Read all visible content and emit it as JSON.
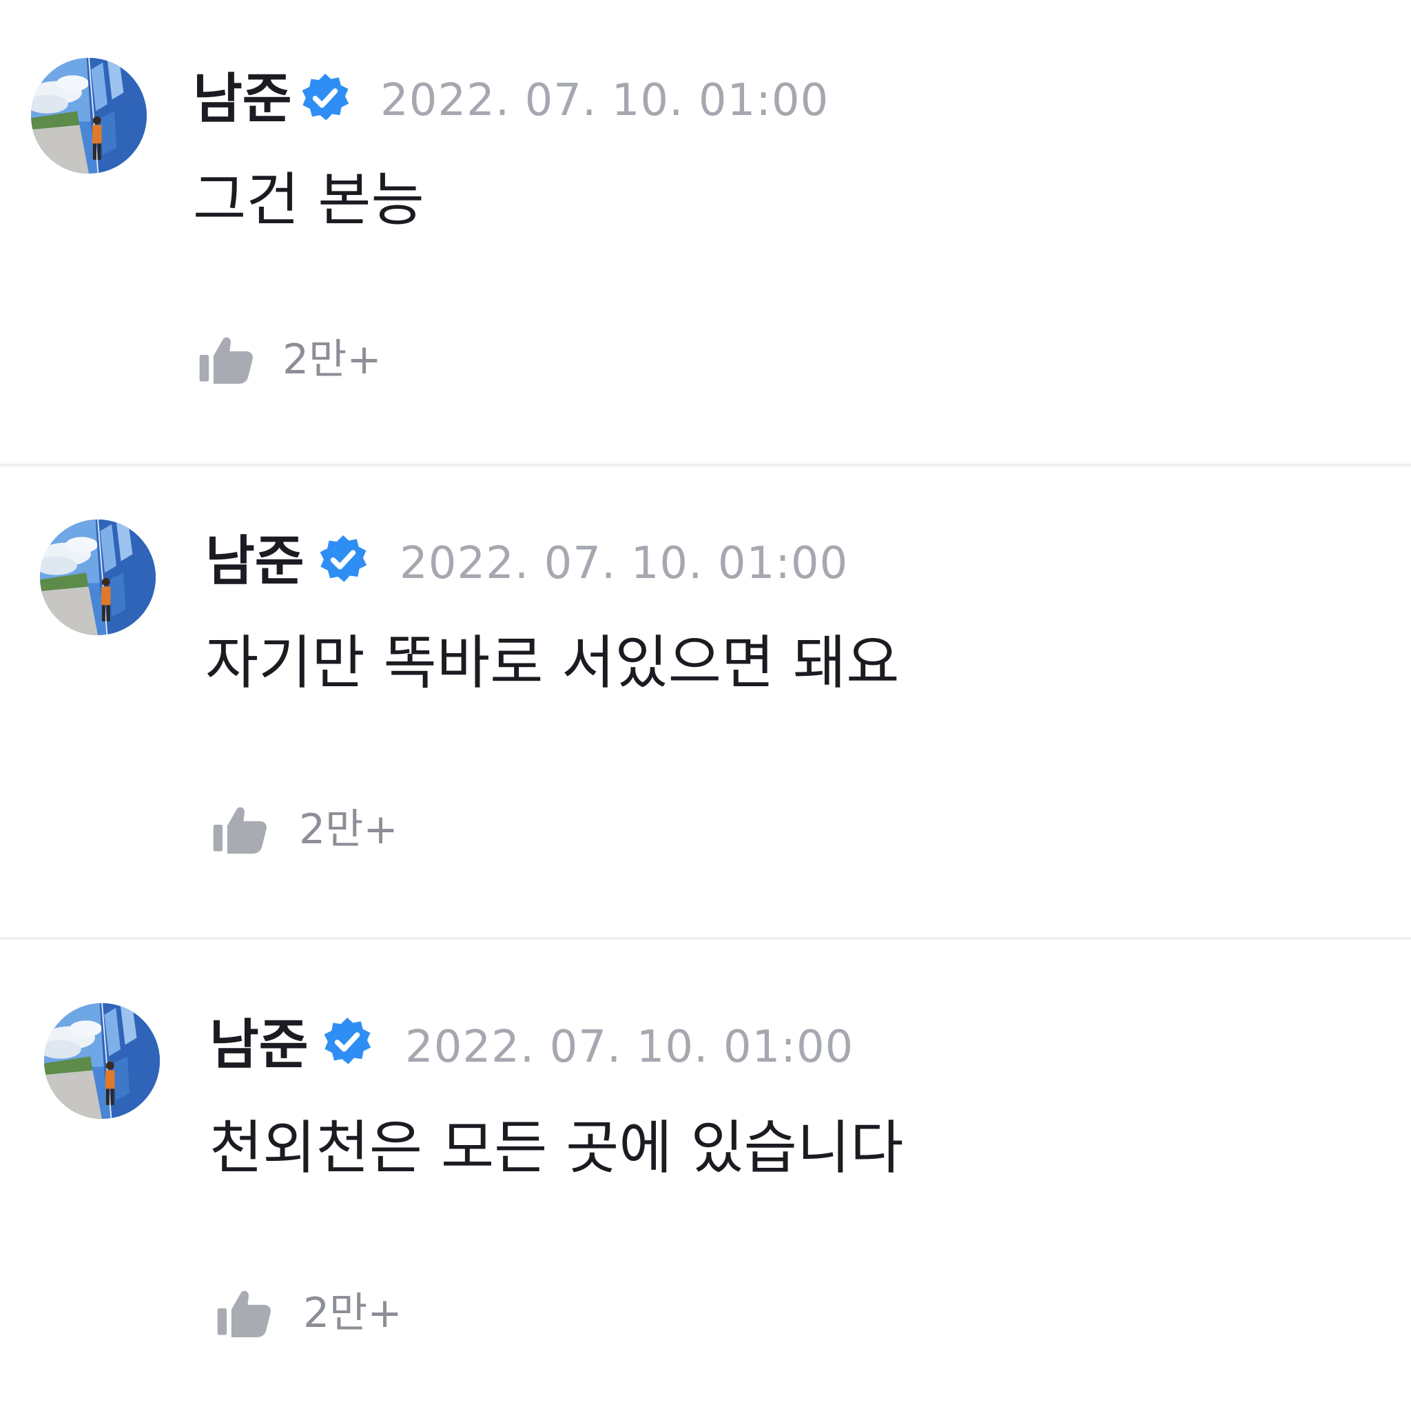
{
  "comments": [
    {
      "author": "남준",
      "timestamp": "2022. 07. 10. 01:00",
      "text": "그건 본능",
      "like_count": "2만+"
    },
    {
      "author": "남준",
      "timestamp": "2022. 07. 10. 01:00",
      "text": "자기만 똑바로 서있으면 돼요",
      "like_count": "2만+"
    },
    {
      "author": "남준",
      "timestamp": "2022. 07. 10. 01:00",
      "text": "천외천은 모든 곳에 있습니다",
      "like_count": "2만+"
    }
  ],
  "icons": {
    "verified": "verified-check-icon",
    "like": "thumbs-up-icon"
  },
  "colors": {
    "verified_badge": "#2f8ef3",
    "like_icon": "#a9abb3",
    "divider": "#eeeff2",
    "timestamp": "#a6a8b0"
  }
}
